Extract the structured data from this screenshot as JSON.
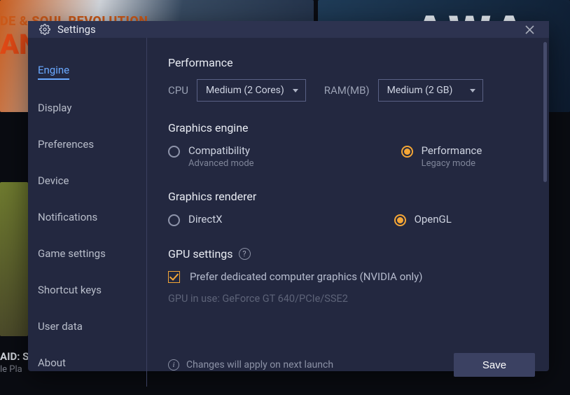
{
  "bg": {
    "banner_line1": "DE & SOUL REVOLUTION",
    "banner_line2": "AN",
    "awa": "AWA",
    "raid_label": "AID: S",
    "raid_sub": "le Pla"
  },
  "header": {
    "title": "Settings"
  },
  "sidebar": {
    "items": [
      {
        "label": "Engine"
      },
      {
        "label": "Display"
      },
      {
        "label": "Preferences"
      },
      {
        "label": "Device"
      },
      {
        "label": "Notifications"
      },
      {
        "label": "Game settings"
      },
      {
        "label": "Shortcut keys"
      },
      {
        "label": "User data"
      },
      {
        "label": "About"
      }
    ]
  },
  "content": {
    "performance": {
      "title": "Performance",
      "cpu_label": "CPU",
      "cpu_value": "Medium (2 Cores)",
      "ram_label": "RAM(MB)",
      "ram_value": "Medium (2 GB)"
    },
    "graphics_engine": {
      "title": "Graphics engine",
      "compat": "Compatibility",
      "compat_sub": "Advanced mode",
      "perf": "Performance",
      "perf_sub": "Legacy mode"
    },
    "graphics_renderer": {
      "title": "Graphics renderer",
      "directx": "DirectX",
      "opengl": "OpenGL"
    },
    "gpu": {
      "title": "GPU settings",
      "prefer": "Prefer dedicated computer graphics (NVIDIA only)",
      "in_use": "GPU in use: GeForce GT 640/PCIe/SSE2"
    },
    "footer": {
      "note": "Changes will apply on next launch",
      "save": "Save"
    }
  }
}
